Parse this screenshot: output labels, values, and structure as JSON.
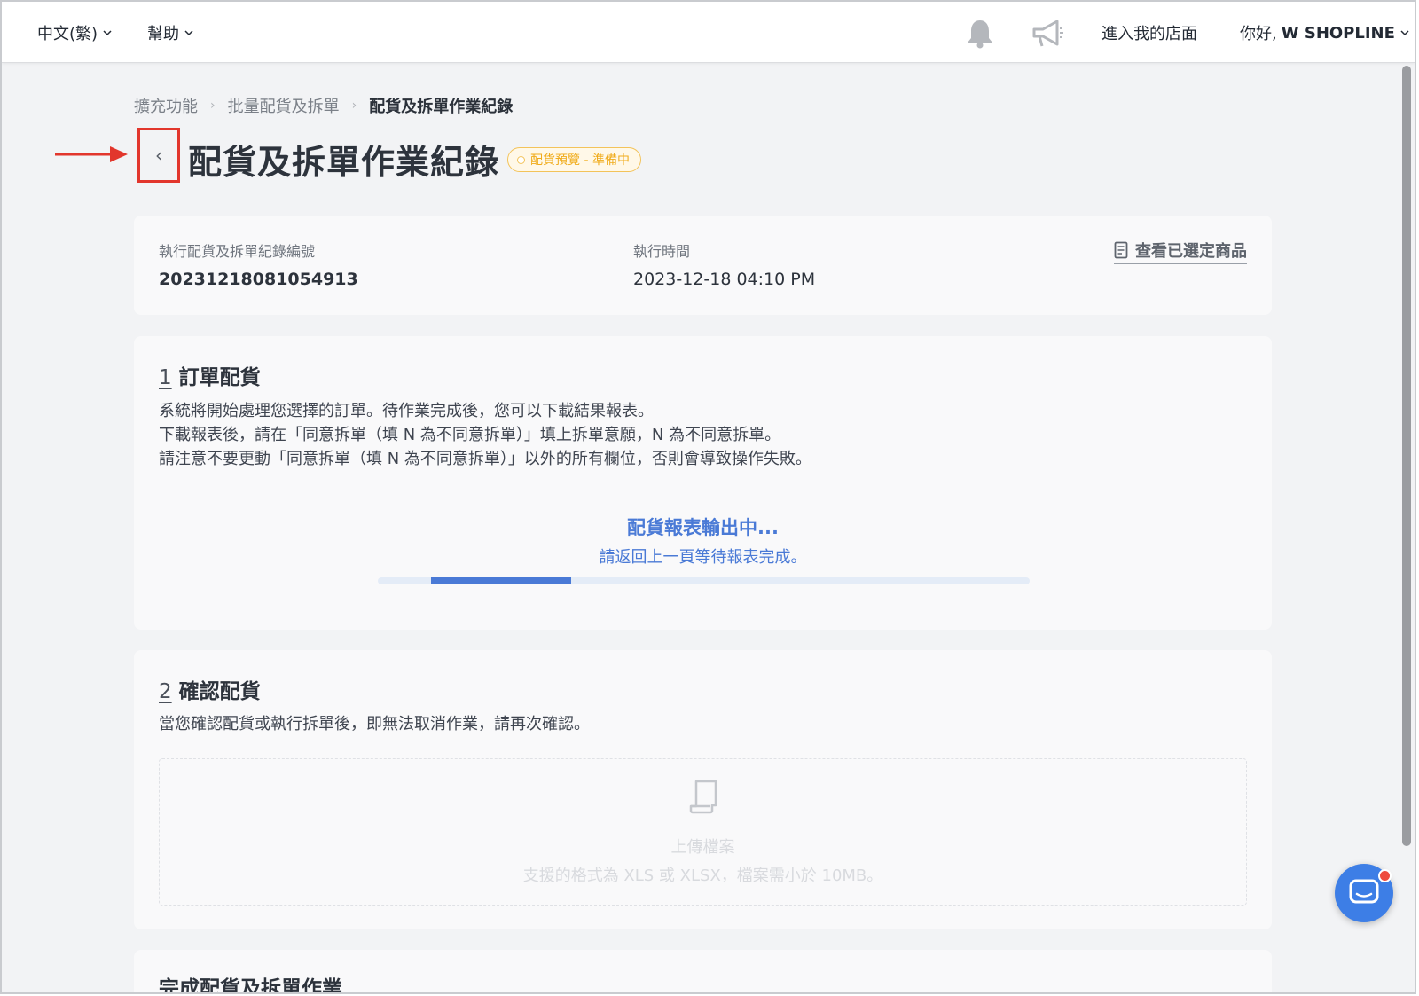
{
  "topbar": {
    "language": "中文(繁)",
    "help": "幫助",
    "enter_store": "進入我的店面",
    "greeting_prefix": "你好,",
    "greeting_name": "W SHOPLINE"
  },
  "breadcrumb": [
    "擴充功能",
    "批量配貨及拆單",
    "配貨及拆單作業紀錄"
  ],
  "page": {
    "back_icon": "‹",
    "title": "配貨及拆單作業紀錄",
    "status_badge": "配貨預覽 - 準備中"
  },
  "info": {
    "record_label": "執行配貨及拆單紀錄編號",
    "record_value": "20231218081054913",
    "time_label": "執行時間",
    "time_value": "2023-12-18 04:10 PM",
    "view_selected": "查看已選定商品"
  },
  "step1": {
    "number": "1",
    "title": "訂單配貨",
    "desc": [
      "系統將開始處理您選擇的訂單。待作業完成後，您可以下載結果報表。",
      "下載報表後，請在「同意拆單（填 N 為不同意拆單）」填上拆單意願，N 為不同意拆單。",
      "請注意不要更動「同意拆單（填 N 為不同意拆單）」以外的所有欄位，否則會導致操作失敗。"
    ],
    "progress_title": "配貨報表輸出中...",
    "progress_sub": "請返回上一頁等待報表完成。",
    "progress_fraction": 0.215
  },
  "step2": {
    "number": "2",
    "title": "確認配貨",
    "desc": "當您確認配貨或執行拆單後，即無法取消作業，請再次確認。",
    "upload_title": "上傳檔案",
    "upload_hint": "支援的格式為 XLS 或 XLSX，檔案需小於 10MB。"
  },
  "step3": {
    "title": "完成配貨及拆單作業"
  },
  "colors": {
    "accent_blue": "#4a7ad6",
    "badge_orange": "#f0ac1c",
    "annotation_red": "#e2362c"
  }
}
